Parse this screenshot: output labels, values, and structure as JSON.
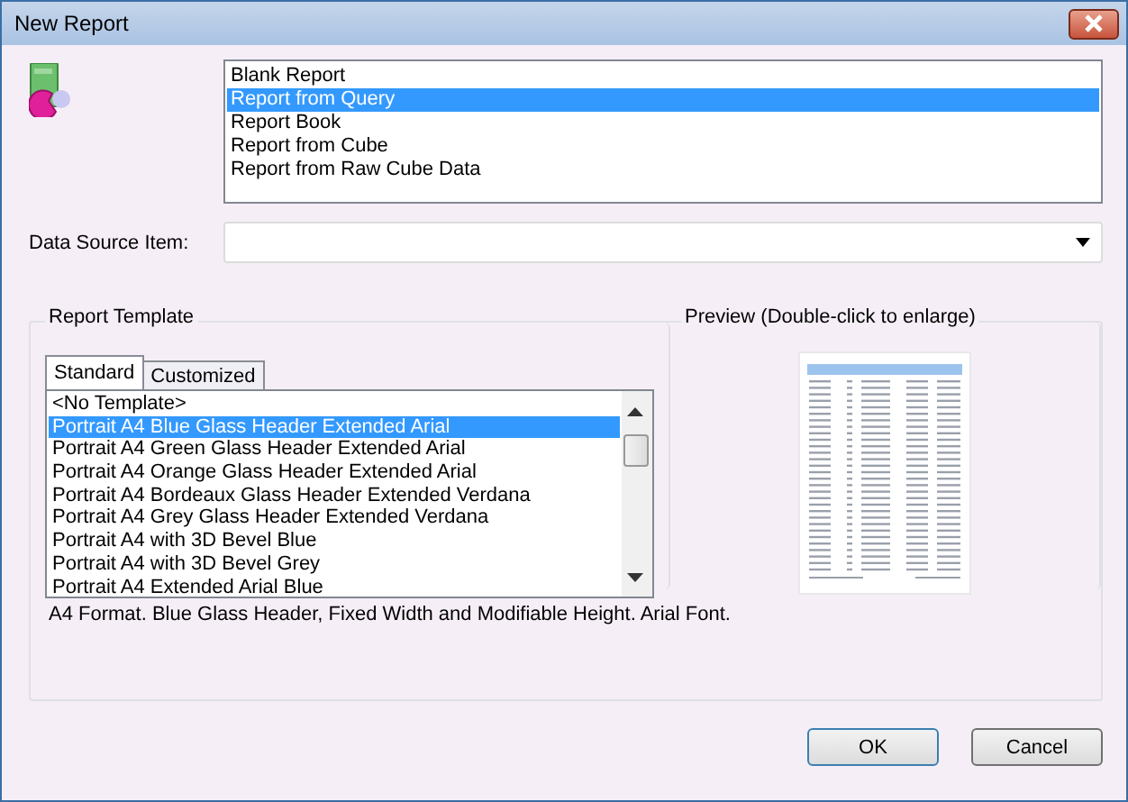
{
  "window": {
    "title": "New Report"
  },
  "report_types": [
    {
      "label": "Blank Report",
      "selected": false
    },
    {
      "label": "Report from Query",
      "selected": true
    },
    {
      "label": "Report Book",
      "selected": false
    },
    {
      "label": "Report from Cube",
      "selected": false
    },
    {
      "label": "Report from Raw Cube Data",
      "selected": false
    }
  ],
  "data_source": {
    "label": "Data Source Item:"
  },
  "report_template": {
    "title": "Report Template",
    "tabs": [
      {
        "label": "Standard",
        "selected": true
      },
      {
        "label": "Customized",
        "selected": false
      }
    ],
    "templates": [
      {
        "label": "<No Template>",
        "selected": false
      },
      {
        "label": "Portrait A4 Blue Glass Header Extended Arial",
        "selected": true
      },
      {
        "label": "Portrait A4 Green Glass Header Extended Arial",
        "selected": false
      },
      {
        "label": "Portrait A4 Orange Glass Header Extended Arial",
        "selected": false
      },
      {
        "label": "Portrait A4 Bordeaux Glass Header Extended Verdana",
        "selected": false
      },
      {
        "label": "Portrait A4 Grey Glass Header Extended Verdana",
        "selected": false
      },
      {
        "label": "Portrait A4 with 3D Bevel Blue",
        "selected": false
      },
      {
        "label": "Portrait A4 with 3D Bevel Grey",
        "selected": false
      },
      {
        "label": "Portrait A4 Extended Arial Blue",
        "selected": false
      }
    ],
    "description": "A4 Format. Blue Glass Header, Fixed Width and Modifiable Height. Arial Font."
  },
  "preview": {
    "title": "Preview (Double-click to enlarge)"
  },
  "buttons": [
    "OK",
    "Cancel"
  ]
}
